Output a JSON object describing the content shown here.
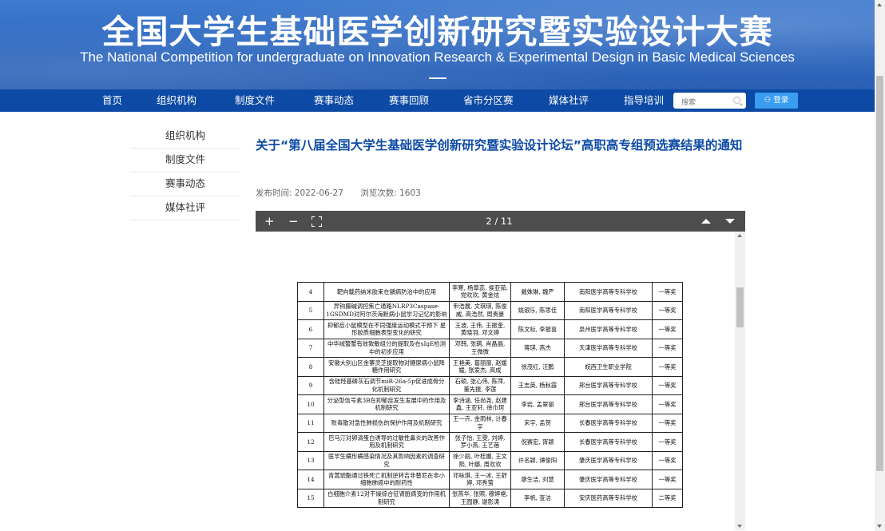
{
  "banner": {
    "title_cn": "全国大学生基础医学创新研究暨实验设计大赛",
    "title_en": "The National Competition for undergraduate on Innovation Research & Experimental Design in Basic Medical Sciences"
  },
  "nav": {
    "items": [
      "首页",
      "组织机构",
      "制度文件",
      "赛事动态",
      "赛事回顾",
      "省市分区赛",
      "媒体社评",
      "指导培训"
    ],
    "search_placeholder": "搜索",
    "login_label": "登录"
  },
  "sidebar": {
    "items": [
      "组织机构",
      "制度文件",
      "赛事动态",
      "媒体社评"
    ]
  },
  "article": {
    "title": "关于“第八届全国大学生基础医学创新研究暨实验设计论坛”高职高专组预选赛结果的通知",
    "publish_time": "发布时间: 2022-06-27",
    "views": "浏览次数: 1603"
  },
  "viewer": {
    "page_indicator": "2 / 11",
    "zoom_in": "+",
    "zoom_out": "−"
  },
  "table": {
    "rows": [
      [
        "4",
        "靶向载药纳米胶束在龋病防治中的应用",
        "李寒, 杨章蕊, 侯亚茹, 党欢欢, 黄金炫",
        "戴姝琳, 魏严",
        "南阳医学高等专科学校",
        "一等奖"
      ],
      [
        "5",
        "异钩藤碱调控焦亡通路NLRP3Caspase-1GSDMD对阿尔茨海默病小鼠学习记忆的影响",
        "申浩展, 文琪琪, 陈俊威, 高浩然, 周贵豪",
        "姚银乐, 陈思佳",
        "南阳医学高等专科学校",
        "一等奖"
      ],
      [
        "6",
        "抑郁症小鼠模型在不同强度运动模式干预下 星形胶质细胞表型变化的研究",
        "王波, 王伟, 王振奎, 黄晓羽, 邓文婷",
        "陈文标, 李振喜",
        "泉州医学高等专科学校",
        "一等奖"
      ],
      [
        "7",
        "中华绒螯蟹有效致敏组分的提取及在sIgE检测中的初步应用",
        "邓韩, 张萌, 肖晶晶, 王微微",
        "蒋琪, 燕杰",
        "天津医学高等专科学校",
        "一等奖"
      ],
      [
        "8",
        "安徽大别山区金寨灵芝提取物对糖尿病小鼠降糖作用研究",
        "王艳美, 葛丽丽, 赵媛媛, 张爱杰, 高成",
        "徐茂红, 汪鹏",
        "皖西卫生职业学院",
        "一等奖"
      ],
      [
        "9",
        "含硅羟基磷灰石调节miR-26a-5p促进成骨分化机制研究",
        "石硕, 张心伟, 陈萍, 董先振, 李莲",
        "王志英, 杨秋霞",
        "邢台医学高等专科学校",
        "一等奖"
      ],
      [
        "10",
        "分泌型信号素3B在抑郁症发生发展中的作用及机制研究",
        "李诗涵, 任尚尧, 赵建鑫, 王亚轩, 徐巾珂",
        "李岩, 孟翠丽",
        "邢台医学高等专科学校",
        "一等奖"
      ],
      [
        "11",
        "败毒散对急性肺损伤的保护作用及机制研究",
        "王一卉, 金雨林, 计春宇",
        "宋宇, 孟贺",
        "长春医学高等专科学校",
        "一等奖"
      ],
      [
        "12",
        "巴马汀对卵清蛋白诱导的过敏性鼻炎的改善作用及机制研究",
        "张子怡, 王雯, 刘婷, 罗小燕, 王艺蓓",
        "倪赛宏, 胥颖",
        "长春医学高等专科学校",
        "一等奖"
      ],
      [
        "13",
        "医学生螨形螨感染情况及其影响因素的调查研究",
        "徐少丽, 叶桂娜, 王文熙, 叶娜, 周欢欢",
        "许名颖, 谭俊阳",
        "肇庆医学高等专科学校",
        "一等奖"
      ],
      [
        "14",
        "青蒿琥酯通过铁死亡机制逆转吉非替尼在非小细胞肺癌中的耐药性",
        "邓咏琪, 王一冰, 王舒婷, 邓秀萤",
        "廖生洁, 刘慧",
        "肇庆医学高等专科学校",
        "一等奖"
      ],
      [
        "15",
        "白细胞介素12对干燥综合征肾脏病变的作用机制研究",
        "张燕华, 张照, 穆婷艳, 王园静, 谢影涛",
        "李帆, 查洁",
        "安庆医药高等专科学校",
        "二等奖"
      ]
    ]
  }
}
